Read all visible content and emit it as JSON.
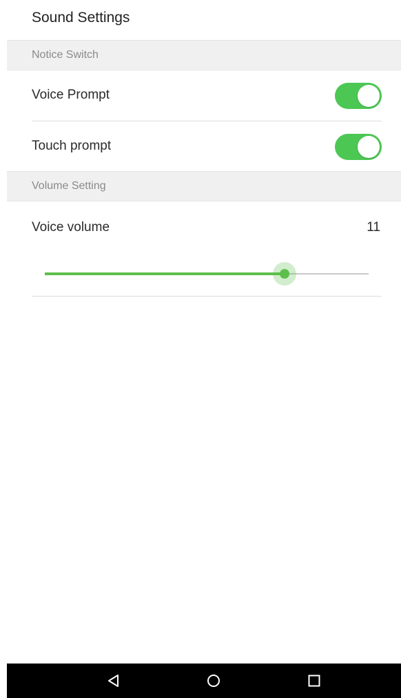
{
  "page": {
    "title": "Sound Settings"
  },
  "sections": {
    "notice": {
      "header": "Notice Switch",
      "items": [
        {
          "label": "Voice Prompt",
          "enabled": true
        },
        {
          "label": "Touch prompt",
          "enabled": true
        }
      ]
    },
    "volume": {
      "header": "Volume Setting",
      "voice_volume": {
        "label": "Voice volume",
        "value": "11",
        "level_fraction": 0.74
      }
    }
  },
  "nav_bar": {
    "buttons": [
      "back-icon",
      "home-icon",
      "recents-icon"
    ]
  },
  "colors": {
    "accent": "#4cc753",
    "slider": "#5cbf4a",
    "section_bg": "#f0f0f0",
    "nav_bg": "#000000"
  }
}
